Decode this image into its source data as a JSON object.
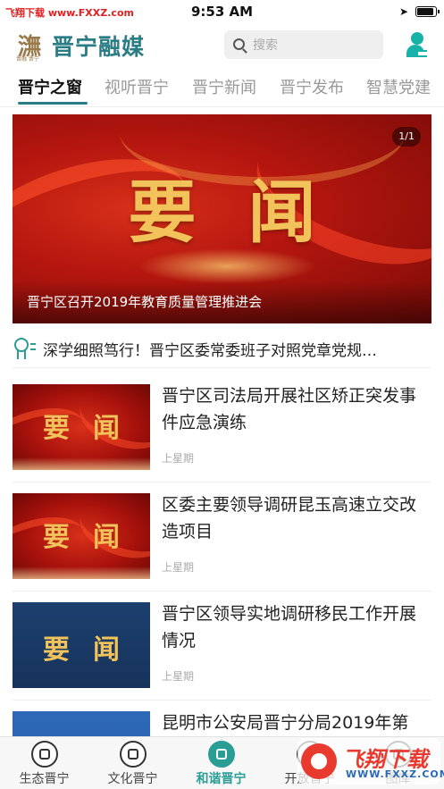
{
  "status_bar": {
    "watermark": "飞翔下载 www.FXXZ.com",
    "time": "9:53 AM"
  },
  "header": {
    "logo_sub": "晋融 晋宁",
    "logo_glyph": "㶃",
    "app_name": "晋宁融媒",
    "search_placeholder": "搜索"
  },
  "tabs": [
    {
      "label": "晋宁之窗",
      "active": true
    },
    {
      "label": "视听晋宁",
      "active": false
    },
    {
      "label": "晋宁新闻",
      "active": false
    },
    {
      "label": "晋宁发布",
      "active": false
    },
    {
      "label": "智慧党建",
      "active": false
    }
  ],
  "banner": {
    "title": "要闻",
    "counter": "1/1",
    "caption": "晋宁区召开2019年教育质量管理推进会"
  },
  "headline": {
    "text": "深学细照笃行！晋宁区委常委班子对照党章党规…"
  },
  "news": [
    {
      "thumb_text": "要闻",
      "title": "晋宁区司法局开展社区矫正突发事件应急演练",
      "time": "上星期"
    },
    {
      "thumb_text": "要闻",
      "title": "区委主要领导调研昆玉高速立交改造项目",
      "time": "上星期"
    },
    {
      "thumb_text": "要闻",
      "title": "晋宁区领导实地调研移民工作开展情况",
      "time": "上星期"
    },
    {
      "thumb_text": "",
      "title": "昆明市公安局晋宁分局2019年第",
      "time": ""
    }
  ],
  "bottom_nav": [
    {
      "label": "生态晋宁",
      "active": false
    },
    {
      "label": "文化晋宁",
      "active": false
    },
    {
      "label": "和谐晋宁",
      "active": true
    },
    {
      "label": "开放晋宁",
      "active": false
    },
    {
      "label": "图库",
      "active": false
    }
  ],
  "watermark": {
    "title": "飞翔下载",
    "url": "WWW.FXXZ.COM"
  },
  "colors": {
    "accent": "#2a7d85",
    "teal": "#2a9d94",
    "news_red": "#b5160f",
    "gold": "#f1c35a"
  }
}
